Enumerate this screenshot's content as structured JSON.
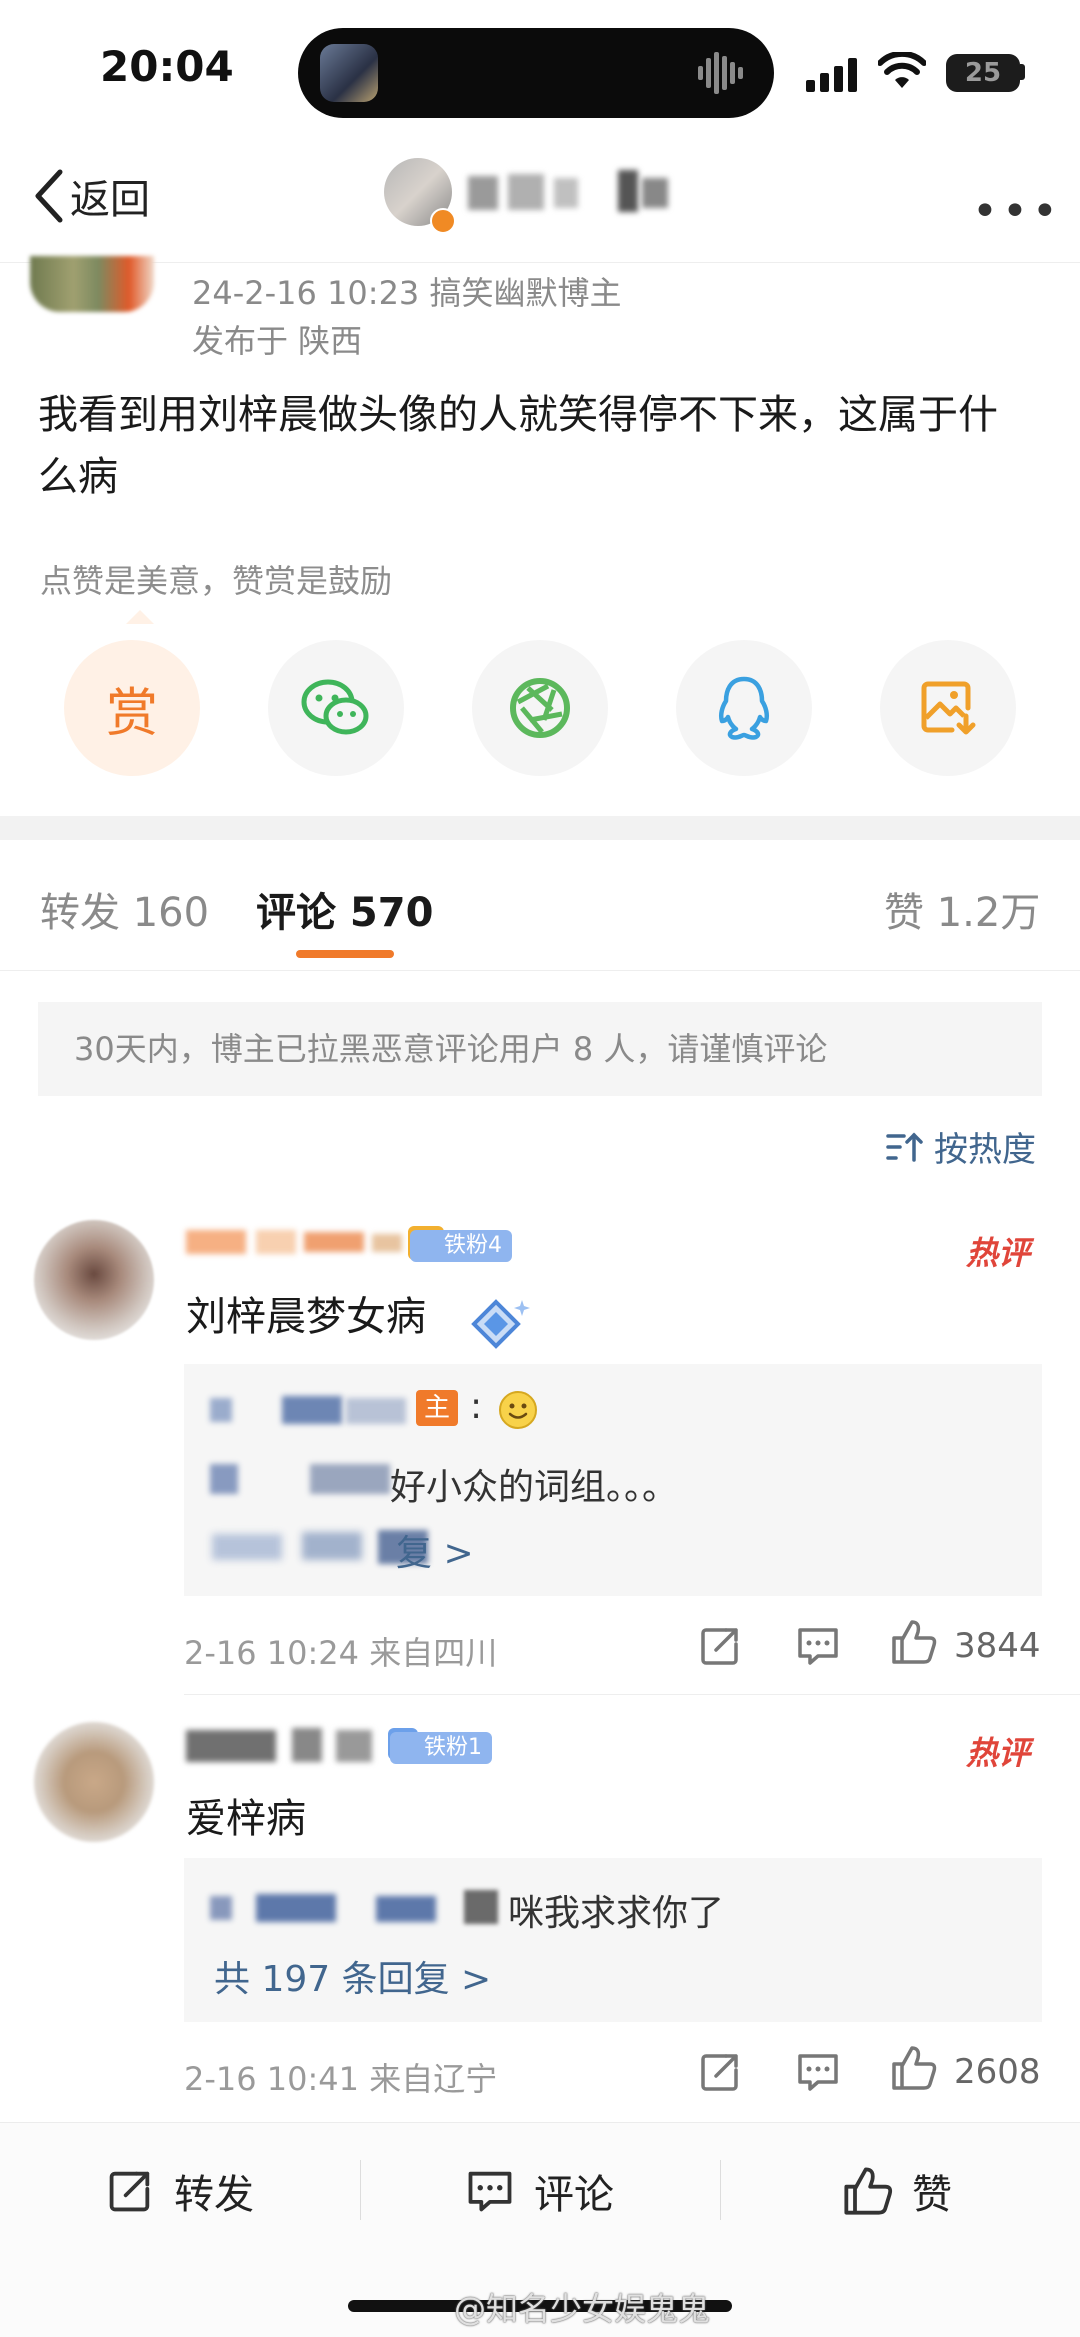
{
  "status_bar": {
    "time": "20:04",
    "battery": "25"
  },
  "header": {
    "back_label": "返回"
  },
  "post": {
    "meta": "24-2-16 10:23  搞笑幽默博主",
    "location": "发布于 陕西",
    "text": "我看到用刘梓晨做头像的人就笑得停不下来，这属于什么病",
    "reward_hint": "点赞是美意，赞赏是鼓励",
    "reward_label": "赏"
  },
  "tabs": {
    "repost": "转发 160",
    "comment": "评论 570",
    "like": "赞 1.2万"
  },
  "notice": "30天内，博主已拉黑恶意评论用户 8 人，请谨慎评论",
  "sort_label": "按热度",
  "comments": [
    {
      "fan_badge": "铁粉4",
      "hot_tag": "热评",
      "text": "刘梓晨梦女病",
      "reply_author_tag": "主",
      "reply_text": "好小众的词组。。。",
      "reply_more": "复 >",
      "time_location": "2-16 10:24  来自四川",
      "likes": "3844"
    },
    {
      "fan_badge": "铁粉1",
      "hot_tag": "热评",
      "text": "爱梓病",
      "reply_text": "咪我求求你了",
      "reply_more": "共 197 条回复 >",
      "time_location": "2-16 10:41  来自辽宁",
      "likes": "2608"
    }
  ],
  "bottom_bar": {
    "repost": "转发",
    "comment": "评论",
    "like": "赞"
  },
  "watermark": "@知名少女娱鬼鬼",
  "colors": {
    "accent": "#f07a2a",
    "link": "#41668e",
    "hot": "#e0453a",
    "fan_badge": "#8fb5ef"
  }
}
